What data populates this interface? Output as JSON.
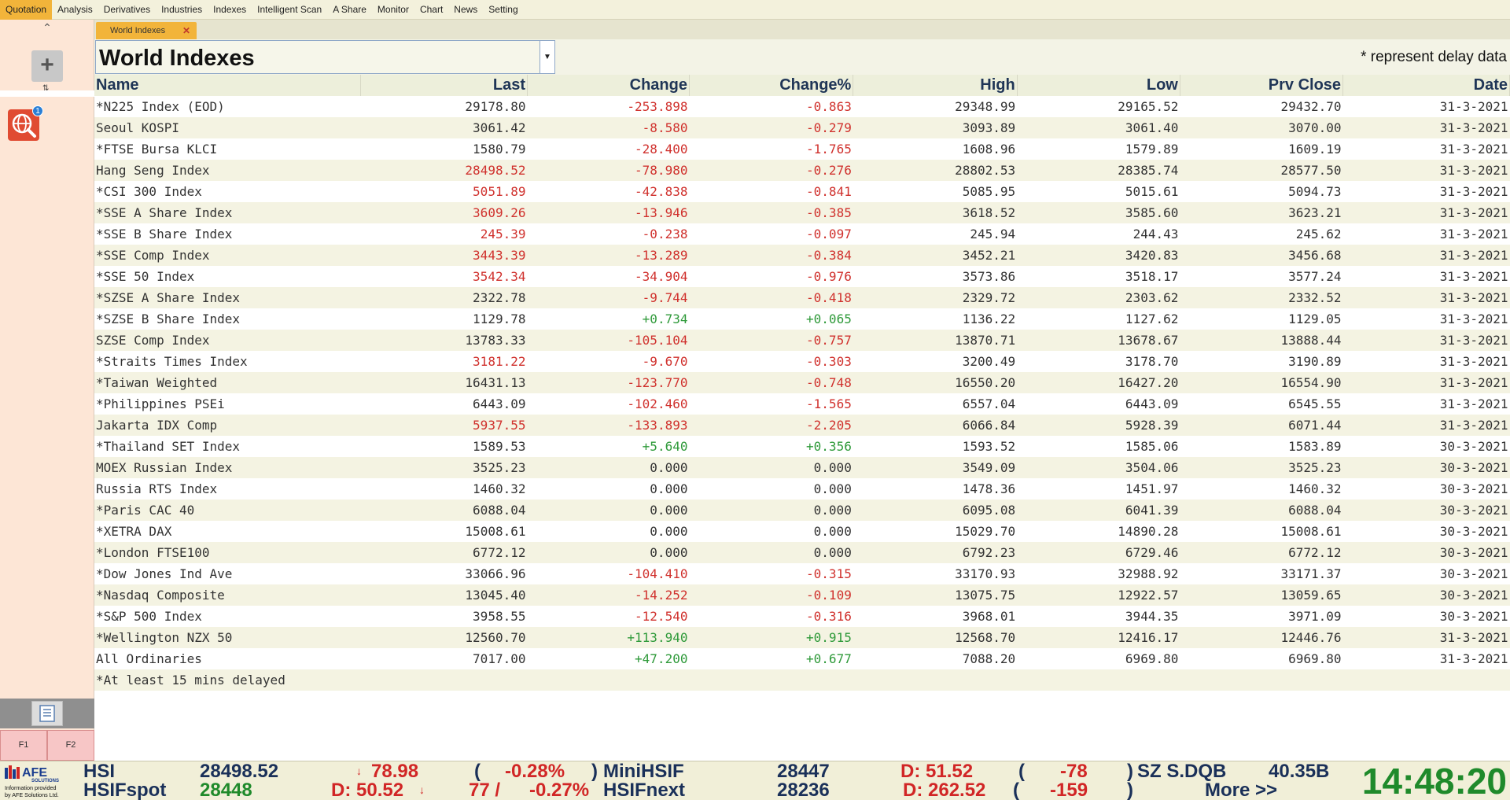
{
  "menu": [
    "Quotation",
    "Analysis",
    "Derivatives",
    "Industries",
    "Indexes",
    "Intelligent Scan",
    "A Share",
    "Monitor",
    "Chart",
    "News",
    "Setting"
  ],
  "active_menu": "Quotation",
  "sidebar": {
    "badge_count": "1",
    "fkeys": [
      "F1",
      "F2"
    ]
  },
  "tab": {
    "label": "World Indexes"
  },
  "title": "World Indexes",
  "delay_note": "*  represent delay data",
  "columns": [
    "Name",
    "Last",
    "Change",
    "Change%",
    "High",
    "Low",
    "Prv Close",
    "Date"
  ],
  "rows": [
    {
      "name": "*N225 Index (EOD)",
      "last": "29178.80",
      "change": "-253.898",
      "pct": "-0.863",
      "high": "29348.99",
      "low": "29165.52",
      "prev": "29432.70",
      "date": "31-3-2021",
      "last_color": "dark",
      "chg_color": "red"
    },
    {
      "name": "Seoul KOSPI",
      "last": "3061.42",
      "change": "-8.580",
      "pct": "-0.279",
      "high": "3093.89",
      "low": "3061.40",
      "prev": "3070.00",
      "date": "31-3-2021",
      "last_color": "dark",
      "chg_color": "red"
    },
    {
      "name": "*FTSE Bursa KLCI",
      "last": "1580.79",
      "change": "-28.400",
      "pct": "-1.765",
      "high": "1608.96",
      "low": "1579.89",
      "prev": "1609.19",
      "date": "31-3-2021",
      "last_color": "dark",
      "chg_color": "red"
    },
    {
      "name": "Hang Seng Index",
      "last": "28498.52",
      "change": "-78.980",
      "pct": "-0.276",
      "high": "28802.53",
      "low": "28385.74",
      "prev": "28577.50",
      "date": "31-3-2021",
      "last_color": "red",
      "chg_color": "red"
    },
    {
      "name": "*CSI 300 Index",
      "last": "5051.89",
      "change": "-42.838",
      "pct": "-0.841",
      "high": "5085.95",
      "low": "5015.61",
      "prev": "5094.73",
      "date": "31-3-2021",
      "last_color": "red",
      "chg_color": "red"
    },
    {
      "name": "*SSE A Share Index",
      "last": "3609.26",
      "change": "-13.946",
      "pct": "-0.385",
      "high": "3618.52",
      "low": "3585.60",
      "prev": "3623.21",
      "date": "31-3-2021",
      "last_color": "red",
      "chg_color": "red"
    },
    {
      "name": "*SSE B Share Index",
      "last": "245.39",
      "change": "-0.238",
      "pct": "-0.097",
      "high": "245.94",
      "low": "244.43",
      "prev": "245.62",
      "date": "31-3-2021",
      "last_color": "red",
      "chg_color": "red"
    },
    {
      "name": "*SSE Comp Index",
      "last": "3443.39",
      "change": "-13.289",
      "pct": "-0.384",
      "high": "3452.21",
      "low": "3420.83",
      "prev": "3456.68",
      "date": "31-3-2021",
      "last_color": "red",
      "chg_color": "red"
    },
    {
      "name": "*SSE 50 Index",
      "last": "3542.34",
      "change": "-34.904",
      "pct": "-0.976",
      "high": "3573.86",
      "low": "3518.17",
      "prev": "3577.24",
      "date": "31-3-2021",
      "last_color": "red",
      "chg_color": "red"
    },
    {
      "name": "*SZSE A Share Index",
      "last": "2322.78",
      "change": "-9.744",
      "pct": "-0.418",
      "high": "2329.72",
      "low": "2303.62",
      "prev": "2332.52",
      "date": "31-3-2021",
      "last_color": "dark",
      "chg_color": "red"
    },
    {
      "name": "*SZSE B Share Index",
      "last": "1129.78",
      "change": "+0.734",
      "pct": "+0.065",
      "high": "1136.22",
      "low": "1127.62",
      "prev": "1129.05",
      "date": "31-3-2021",
      "last_color": "dark",
      "chg_color": "green"
    },
    {
      "name": "SZSE Comp Index",
      "last": "13783.33",
      "change": "-105.104",
      "pct": "-0.757",
      "high": "13870.71",
      "low": "13678.67",
      "prev": "13888.44",
      "date": "31-3-2021",
      "last_color": "dark",
      "chg_color": "red"
    },
    {
      "name": "*Straits Times Index",
      "last": "3181.22",
      "change": "-9.670",
      "pct": "-0.303",
      "high": "3200.49",
      "low": "3178.70",
      "prev": "3190.89",
      "date": "31-3-2021",
      "last_color": "red",
      "chg_color": "red"
    },
    {
      "name": "*Taiwan Weighted",
      "last": "16431.13",
      "change": "-123.770",
      "pct": "-0.748",
      "high": "16550.20",
      "low": "16427.20",
      "prev": "16554.90",
      "date": "31-3-2021",
      "last_color": "dark",
      "chg_color": "red"
    },
    {
      "name": "*Philippines PSEi",
      "last": "6443.09",
      "change": "-102.460",
      "pct": "-1.565",
      "high": "6557.04",
      "low": "6443.09",
      "prev": "6545.55",
      "date": "31-3-2021",
      "last_color": "dark",
      "chg_color": "red"
    },
    {
      "name": "Jakarta IDX Comp",
      "last": "5937.55",
      "change": "-133.893",
      "pct": "-2.205",
      "high": "6066.84",
      "low": "5928.39",
      "prev": "6071.44",
      "date": "31-3-2021",
      "last_color": "red",
      "chg_color": "red"
    },
    {
      "name": "*Thailand SET Index",
      "last": "1589.53",
      "change": "+5.640",
      "pct": "+0.356",
      "high": "1593.52",
      "low": "1585.06",
      "prev": "1583.89",
      "date": "30-3-2021",
      "last_color": "dark",
      "chg_color": "green"
    },
    {
      "name": "MOEX Russian Index",
      "last": "3525.23",
      "change": "0.000",
      "pct": "0.000",
      "high": "3549.09",
      "low": "3504.06",
      "prev": "3525.23",
      "date": "30-3-2021",
      "last_color": "dark",
      "chg_color": "dark"
    },
    {
      "name": "Russia RTS Index",
      "last": "1460.32",
      "change": "0.000",
      "pct": "0.000",
      "high": "1478.36",
      "low": "1451.97",
      "prev": "1460.32",
      "date": "30-3-2021",
      "last_color": "dark",
      "chg_color": "dark"
    },
    {
      "name": "*Paris CAC 40",
      "last": "6088.04",
      "change": "0.000",
      "pct": "0.000",
      "high": "6095.08",
      "low": "6041.39",
      "prev": "6088.04",
      "date": "30-3-2021",
      "last_color": "dark",
      "chg_color": "dark"
    },
    {
      "name": "*XETRA DAX",
      "last": "15008.61",
      "change": "0.000",
      "pct": "0.000",
      "high": "15029.70",
      "low": "14890.28",
      "prev": "15008.61",
      "date": "30-3-2021",
      "last_color": "dark",
      "chg_color": "dark"
    },
    {
      "name": "*London FTSE100",
      "last": "6772.12",
      "change": "0.000",
      "pct": "0.000",
      "high": "6792.23",
      "low": "6729.46",
      "prev": "6772.12",
      "date": "30-3-2021",
      "last_color": "dark",
      "chg_color": "dark"
    },
    {
      "name": "*Dow Jones Ind Ave",
      "last": "33066.96",
      "change": "-104.410",
      "pct": "-0.315",
      "high": "33170.93",
      "low": "32988.92",
      "prev": "33171.37",
      "date": "30-3-2021",
      "last_color": "dark",
      "chg_color": "red"
    },
    {
      "name": "*Nasdaq Composite",
      "last": "13045.40",
      "change": "-14.252",
      "pct": "-0.109",
      "high": "13075.75",
      "low": "12922.57",
      "prev": "13059.65",
      "date": "30-3-2021",
      "last_color": "dark",
      "chg_color": "red"
    },
    {
      "name": "*S&P 500 Index",
      "last": "3958.55",
      "change": "-12.540",
      "pct": "-0.316",
      "high": "3968.01",
      "low": "3944.35",
      "prev": "3971.09",
      "date": "30-3-2021",
      "last_color": "dark",
      "chg_color": "red"
    },
    {
      "name": "*Wellington NZX 50",
      "last": "12560.70",
      "change": "+113.940",
      "pct": "+0.915",
      "high": "12568.70",
      "low": "12416.17",
      "prev": "12446.76",
      "date": "31-3-2021",
      "last_color": "dark",
      "chg_color": "green"
    },
    {
      "name": "All Ordinaries",
      "last": "7017.00",
      "change": "+47.200",
      "pct": "+0.677",
      "high": "7088.20",
      "low": "6969.80",
      "prev": "6969.80",
      "date": "31-3-2021",
      "last_color": "dark",
      "chg_color": "green"
    }
  ],
  "footnote": "*At least 15 mins delayed",
  "footer": {
    "logo_text": "AFE",
    "logo_sub": "SOLUTIONS",
    "logo_caption1": "Information provided",
    "logo_caption2": "by AFE Solutions Ltd.",
    "hsi_label": "HSI",
    "hsi_value": "28498.52",
    "hsi_change": "78.98",
    "hsi_paren_open": "(",
    "hsi_pct": "-0.28%",
    "hsi_paren_close": ")",
    "hsifspot_label": "HSIFspot",
    "hsifspot_value": "28448",
    "hsifspot_d": "D: 50.52",
    "hsifspot_change": "77 /",
    "hsifspot_pct": "-0.27%",
    "minihsif_label": "MiniHSIF",
    "minihsif_value": "28447",
    "minihsif_d": "D: 51.52",
    "minihsif_paren_open": "(",
    "minihsif_change": "-78",
    "minihsif_paren_close": ")",
    "hsifnext_label": "HSIFnext",
    "hsifnext_value": "28236",
    "hsifnext_d": "D: 262.52",
    "hsifnext_paren_open": "(",
    "hsifnext_change": "-159",
    "hsifnext_paren_close": ")",
    "sz_label": "SZ S.DQB",
    "sz_value": "40.35B",
    "more_label": "More >>",
    "clock": "14:48:20"
  },
  "colors": {
    "accent": "#f2b43a",
    "up": "#2f9a3a",
    "down": "#d0312d",
    "header_text": "#1f3556"
  }
}
